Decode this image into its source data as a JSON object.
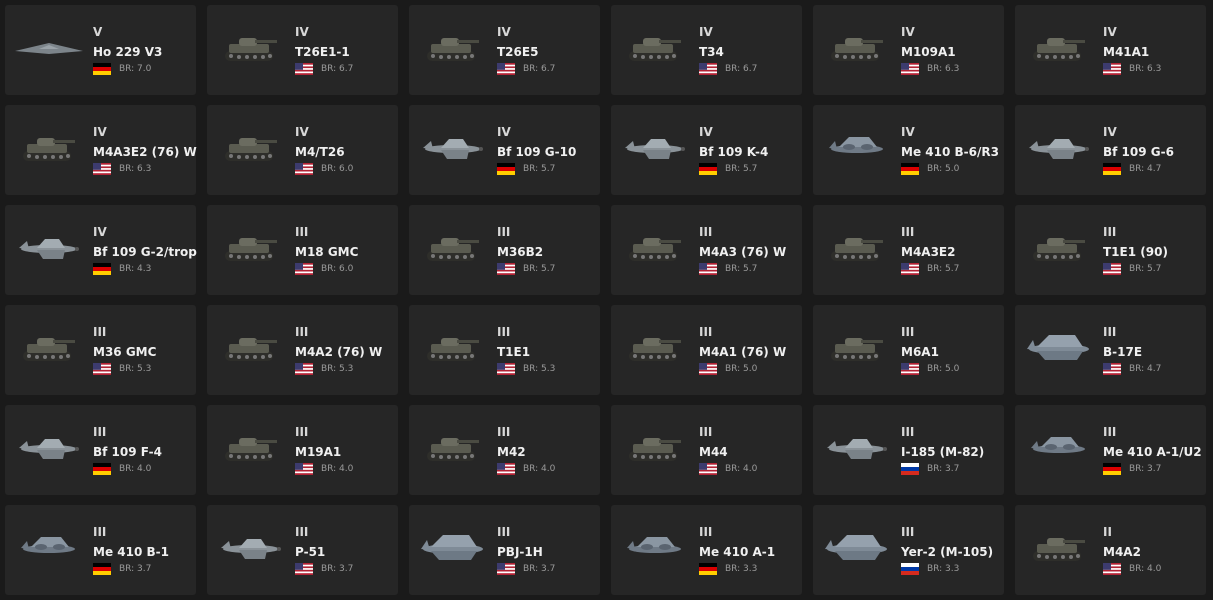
{
  "vehicles": [
    {
      "rank": "V",
      "name": "Ho 229 V3",
      "nation": "germany",
      "icon": "flying-wing-icon",
      "br": "BR: 7.0"
    },
    {
      "rank": "IV",
      "name": "T26E1-1",
      "nation": "usa",
      "icon": "tank-icon",
      "br": "BR: 6.7"
    },
    {
      "rank": "IV",
      "name": "T26E5",
      "nation": "usa",
      "icon": "tank-icon",
      "br": "BR: 6.7"
    },
    {
      "rank": "IV",
      "name": "T34",
      "nation": "usa",
      "icon": "tank-icon",
      "br": "BR: 6.7"
    },
    {
      "rank": "IV",
      "name": "M109A1",
      "nation": "usa",
      "icon": "tank-icon",
      "br": "BR: 6.3"
    },
    {
      "rank": "IV",
      "name": "M41A1",
      "nation": "usa",
      "icon": "tank-icon",
      "br": "BR: 6.3"
    },
    {
      "rank": "IV",
      "name": "M4A3E2 (76) W",
      "nation": "usa",
      "icon": "tank-icon",
      "br": "BR: 6.3"
    },
    {
      "rank": "IV",
      "name": "M4/T26",
      "nation": "usa",
      "icon": "tank-icon",
      "br": "BR: 6.0"
    },
    {
      "rank": "IV",
      "name": "Bf 109 G-10",
      "nation": "germany",
      "icon": "plane-icon",
      "br": "BR: 5.7"
    },
    {
      "rank": "IV",
      "name": "Bf 109 K-4",
      "nation": "germany",
      "icon": "plane-icon",
      "br": "BR: 5.7"
    },
    {
      "rank": "IV",
      "name": "Me 410 B-6/R3",
      "nation": "germany",
      "icon": "twin-plane-icon",
      "br": "BR: 5.0"
    },
    {
      "rank": "IV",
      "name": "Bf 109 G-6",
      "nation": "germany",
      "icon": "plane-icon",
      "br": "BR: 4.7"
    },
    {
      "rank": "IV",
      "name": "Bf 109 G-2/trop",
      "nation": "germany",
      "icon": "plane-icon",
      "br": "BR: 4.3"
    },
    {
      "rank": "III",
      "name": "M18 GMC",
      "nation": "usa",
      "icon": "tank-icon",
      "br": "BR: 6.0"
    },
    {
      "rank": "III",
      "name": "M36B2",
      "nation": "usa",
      "icon": "tank-icon",
      "br": "BR: 5.7"
    },
    {
      "rank": "III",
      "name": "M4A3 (76) W",
      "nation": "usa",
      "icon": "tank-icon",
      "br": "BR: 5.7"
    },
    {
      "rank": "III",
      "name": "M4A3E2",
      "nation": "usa",
      "icon": "tank-icon",
      "br": "BR: 5.7"
    },
    {
      "rank": "III",
      "name": "T1E1 (90)",
      "nation": "usa",
      "icon": "tank-icon",
      "br": "BR: 5.7"
    },
    {
      "rank": "III",
      "name": "M36 GMC",
      "nation": "usa",
      "icon": "tank-icon",
      "br": "BR: 5.3"
    },
    {
      "rank": "III",
      "name": "M4A2 (76) W",
      "nation": "usa",
      "icon": "tank-icon",
      "br": "BR: 5.3"
    },
    {
      "rank": "III",
      "name": "T1E1",
      "nation": "usa",
      "icon": "tank-icon",
      "br": "BR: 5.3"
    },
    {
      "rank": "III",
      "name": "M4A1 (76) W",
      "nation": "usa",
      "icon": "tank-icon",
      "br": "BR: 5.0"
    },
    {
      "rank": "III",
      "name": "M6A1",
      "nation": "usa",
      "icon": "tank-icon",
      "br": "BR: 5.0"
    },
    {
      "rank": "III",
      "name": "B-17E",
      "nation": "usa",
      "icon": "bomber-icon",
      "br": "BR: 4.7"
    },
    {
      "rank": "III",
      "name": "Bf 109 F-4",
      "nation": "germany",
      "icon": "plane-icon",
      "br": "BR: 4.0"
    },
    {
      "rank": "III",
      "name": "M19A1",
      "nation": "usa",
      "icon": "tank-icon",
      "br": "BR: 4.0"
    },
    {
      "rank": "III",
      "name": "M42",
      "nation": "usa",
      "icon": "tank-icon",
      "br": "BR: 4.0"
    },
    {
      "rank": "III",
      "name": "M44",
      "nation": "usa",
      "icon": "tank-icon",
      "br": "BR: 4.0"
    },
    {
      "rank": "III",
      "name": "I-185 (M-82)",
      "nation": "russia",
      "icon": "plane-icon",
      "br": "BR: 3.7"
    },
    {
      "rank": "III",
      "name": "Me 410 A-1/U2",
      "nation": "germany",
      "icon": "twin-plane-icon",
      "br": "BR: 3.7"
    },
    {
      "rank": "III",
      "name": "Me 410 B-1",
      "nation": "germany",
      "icon": "twin-plane-icon",
      "br": "BR: 3.7"
    },
    {
      "rank": "III",
      "name": "P-51",
      "nation": "usa",
      "icon": "plane-icon",
      "br": "BR: 3.7"
    },
    {
      "rank": "III",
      "name": "PBJ-1H",
      "nation": "usa",
      "icon": "bomber-icon",
      "br": "BR: 3.7"
    },
    {
      "rank": "III",
      "name": "Me 410 A-1",
      "nation": "germany",
      "icon": "twin-plane-icon",
      "br": "BR: 3.3"
    },
    {
      "rank": "III",
      "name": "Yer-2 (M-105)",
      "nation": "russia",
      "icon": "bomber-icon",
      "br": "BR: 3.3"
    },
    {
      "rank": "II",
      "name": "M4A2",
      "nation": "usa",
      "icon": "tank-icon",
      "br": "BR: 4.0"
    }
  ]
}
